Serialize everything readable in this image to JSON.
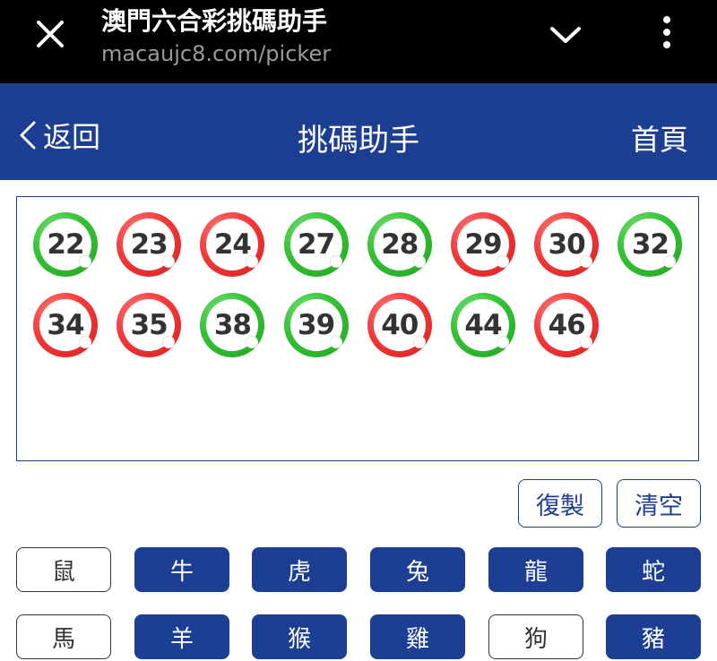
{
  "browser": {
    "title": "澳門六合彩挑碼助手",
    "url": "macaujc8.com/picker"
  },
  "header": {
    "back_label": "返回",
    "title": "挑碼助手",
    "home_label": "首頁"
  },
  "selected_numbers": [
    {
      "num": "22",
      "color": "green"
    },
    {
      "num": "23",
      "color": "red"
    },
    {
      "num": "24",
      "color": "red"
    },
    {
      "num": "27",
      "color": "green"
    },
    {
      "num": "28",
      "color": "green"
    },
    {
      "num": "29",
      "color": "red"
    },
    {
      "num": "30",
      "color": "red"
    },
    {
      "num": "32",
      "color": "green"
    },
    {
      "num": "34",
      "color": "red"
    },
    {
      "num": "35",
      "color": "red"
    },
    {
      "num": "38",
      "color": "green"
    },
    {
      "num": "39",
      "color": "green"
    },
    {
      "num": "40",
      "color": "red"
    },
    {
      "num": "44",
      "color": "green"
    },
    {
      "num": "46",
      "color": "red"
    }
  ],
  "actions": {
    "copy_label": "復製",
    "clear_label": "清空"
  },
  "zodiac": [
    {
      "label": "鼠",
      "active": false
    },
    {
      "label": "牛",
      "active": true
    },
    {
      "label": "虎",
      "active": true
    },
    {
      "label": "兔",
      "active": true
    },
    {
      "label": "龍",
      "active": true
    },
    {
      "label": "蛇",
      "active": true
    },
    {
      "label": "馬",
      "active": false
    },
    {
      "label": "羊",
      "active": true
    },
    {
      "label": "猴",
      "active": true
    },
    {
      "label": "雞",
      "active": true
    },
    {
      "label": "狗",
      "active": false
    },
    {
      "label": "豬",
      "active": true
    }
  ],
  "colors": {
    "brand_blue": "#1c3f94",
    "ball_red": "#f23b3b",
    "ball_green": "#34c134"
  },
  "icons": {
    "close": "close-icon",
    "dropdown": "chevron-down-icon",
    "menu": "more-vertical-icon",
    "back": "chevron-left-icon"
  }
}
